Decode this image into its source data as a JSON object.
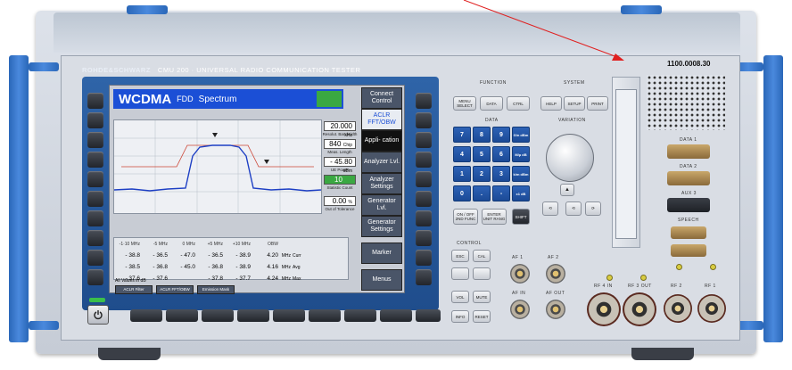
{
  "device": {
    "brand": "ROHDE&SCHWARZ",
    "model": "CMU 200 · UNIVERSAL RADIO COMMUNICATION TESTER",
    "serial_label": "1100.0008.30"
  },
  "display": {
    "title": "WCDMA",
    "title_mode": "FDD",
    "title_screen": "Spectrum",
    "right_menu": [
      {
        "label": "Connect Control",
        "active": false
      },
      {
        "label": "ACLR FFT/OBW",
        "active": true
      },
      {
        "label": "Appli- cation",
        "active": false
      },
      {
        "label": "Analyzer Lvl.",
        "active": false
      },
      {
        "label": "Analyzer Settings",
        "active": false
      },
      {
        "label": "Generator Lvl.",
        "active": false
      },
      {
        "label": "Generator Settings",
        "active": false
      },
      {
        "label": "Marker",
        "active": false
      },
      {
        "label": "Menus",
        "active": false
      }
    ],
    "readouts": [
      {
        "value": "20.000",
        "unit": "kHz",
        "caption": "Resolut. Bandwidth"
      },
      {
        "value": "840",
        "unit": "Chip",
        "caption": "Meas. Length"
      },
      {
        "value": "- 45.80",
        "unit": "dBm",
        "caption": "UE Power"
      },
      {
        "value": "10",
        "unit": "",
        "caption": "Statistic Count"
      },
      {
        "value": "0.00",
        "unit": "%",
        "caption": "Out of Tolerance"
      }
    ],
    "table_headers": [
      "-1·10 MHz",
      "-5 MHz",
      "0 MHz",
      "+5 MHz",
      "+10 MHz",
      "OBW"
    ],
    "table_rows": [
      {
        "values": [
          "- 38.8",
          "- 36.5",
          "- 47.0",
          "- 36.5",
          "- 38.9",
          "4.20"
        ],
        "unit": "MHz",
        "label": "Curr"
      },
      {
        "values": [
          "- 38.5",
          "- 36.8",
          "- 45.0",
          "- 36.8",
          "- 38.9",
          "4.16"
        ],
        "unit": "MHz",
        "label": "Avg"
      },
      {
        "values": [
          "- 37.6",
          "- 37.6",
          "",
          "- 37.8",
          "- 37.7",
          "4.24"
        ],
        "unit": "MHz",
        "label": "Max"
      }
    ],
    "values_in": "All Values in dB",
    "bottom_tabs": [
      "ACLR Filter",
      "ACLR FFT/OBW",
      "Emission Mask"
    ]
  },
  "function_panel": {
    "label": "FUNCTION",
    "keys": [
      "MENU SELECT",
      "DATA",
      "CTRL"
    ]
  },
  "system_panel": {
    "label": "SYSTEM",
    "keys": [
      "HELP",
      "SETUP",
      "PRINT"
    ]
  },
  "data_panel": {
    "label": "DATA",
    "digits": [
      "7",
      "8",
      "9",
      "4",
      "5",
      "6",
      "1",
      "2",
      "3",
      "0",
      ".",
      "-"
    ],
    "unit_keys": [
      "G/n dBm",
      "M/µ dB",
      "k/m dBm",
      "x1 dB"
    ],
    "extra_keys": [
      "ON / OFF 2ND FUNC",
      "ENTER UNIT RANG",
      "SHIFT"
    ]
  },
  "variation_panel": {
    "label": "VARIATION"
  },
  "control_panel": {
    "label": "CONTROL",
    "keys": [
      "ESC",
      "CAL",
      "VOL",
      "MUTE",
      "INFO",
      "RESET"
    ]
  },
  "rf_ports": [
    {
      "label": "AF 1"
    },
    {
      "label": "AF 2"
    },
    {
      "label": "AF IN"
    },
    {
      "label": "AF OUT"
    },
    {
      "label": "RF 4 IN"
    },
    {
      "label": "RF 3 OUT"
    },
    {
      "label": "RF 2"
    },
    {
      "label": "RF 1"
    }
  ],
  "rear_ports": [
    "DATA 1",
    "DATA 2",
    "AUX 3",
    "SPEECH",
    "AUX 4"
  ],
  "power_key": "power-icon",
  "colors": {
    "title_blue": "#1b4fd6",
    "bezel_blue": "#2657a0",
    "rail_blue": "#3a7bd0"
  }
}
